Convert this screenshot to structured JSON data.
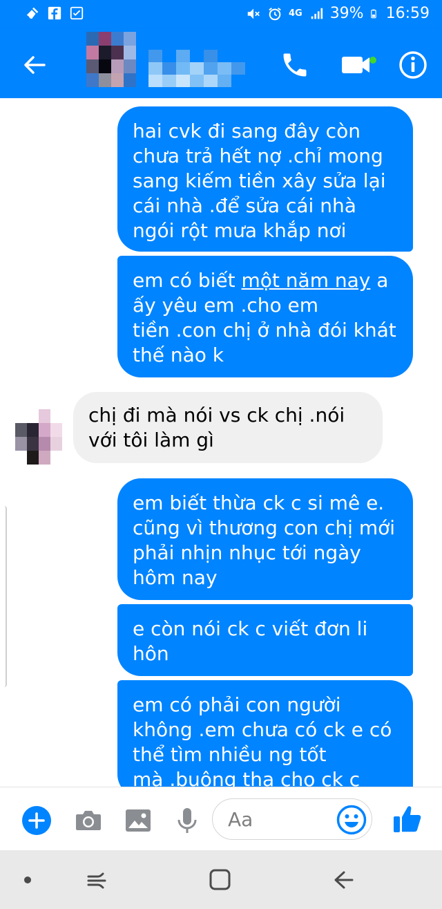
{
  "status_bar": {
    "network_label": "4G",
    "battery": "39%",
    "time": "16:59",
    "icons": [
      "broom-icon",
      "facebook-icon",
      "checkbox-icon",
      "mute-icon",
      "alarm-icon",
      "signal-icon",
      "battery-icon"
    ]
  },
  "header": {
    "contact_name": "",
    "icons": [
      "back-arrow-icon",
      "phone-icon",
      "video-camera-icon",
      "info-icon"
    ],
    "accent_color": "#0084ff",
    "online_color": "#44d62c"
  },
  "messages": [
    {
      "direction": "out",
      "text": "hai cvk đi sang đây còn\nchưa trả hết nợ .chỉ mong\nsang kiếm tiền xây sửa lại\ncái nhà .để sửa cái nhà\nngói rột mưa khắp nơi"
    },
    {
      "direction": "out",
      "text_before": "em có biết ",
      "link_text": "một năm nay",
      "text_after": " a\nấy yêu em .cho em\ntiền .con chị ở nhà đói khát\nthế nào k"
    },
    {
      "direction": "in",
      "text": "chị đi mà nói vs ck chị .nói\nvới tôi làm gì"
    },
    {
      "direction": "out",
      "text": "em biết thừa ck c si mê e.\ncũng vì thương con chị mới\nphải nhịn nhục tới ngày\nhôm nay"
    },
    {
      "direction": "out",
      "text": "e còn nói ck c viết đơn li\nhôn"
    },
    {
      "direction": "out",
      "text": "em có phải con người\nkhông .em chưa có ck e có\nthể tìm nhiều ng tốt\nmà .buông tha cho ck c"
    }
  ],
  "composer": {
    "placeholder": "Aa",
    "icons": [
      "plus-icon",
      "camera-icon",
      "image-icon",
      "microphone-icon",
      "emoji-icon",
      "thumbs-up-icon"
    ]
  },
  "nav_bar": {
    "icons": [
      "dot-icon",
      "recent-apps-icon",
      "home-icon",
      "back-icon"
    ]
  },
  "colors": {
    "outgoing_bubble": "#0084ff",
    "incoming_bubble": "#f0f0f0",
    "nav_bar": "#e9e9e9"
  }
}
